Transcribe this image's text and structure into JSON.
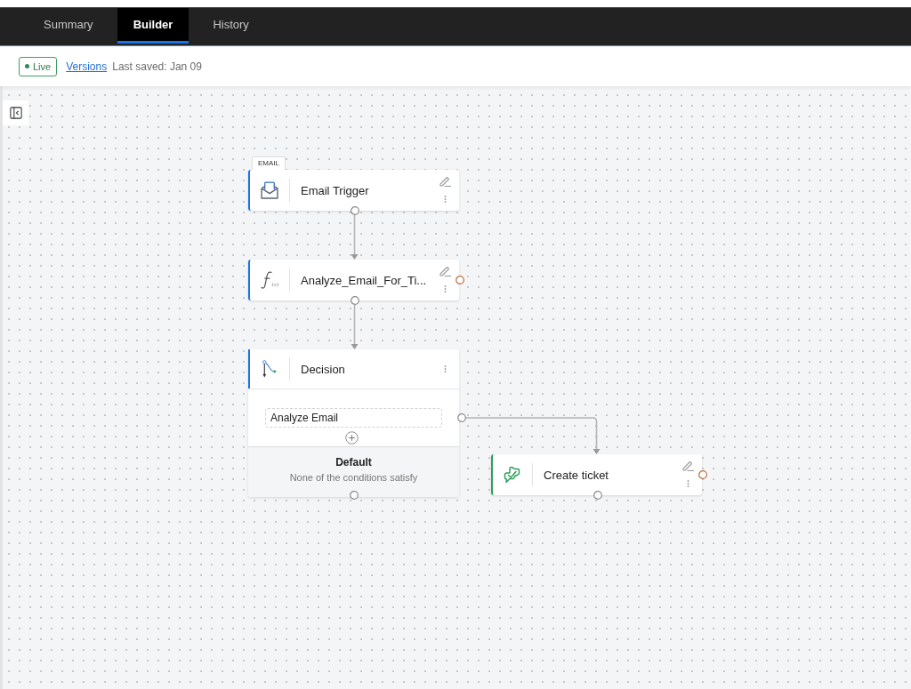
{
  "tabs": [
    {
      "label": "Summary",
      "selected": false
    },
    {
      "label": "Builder",
      "selected": true
    },
    {
      "label": "History",
      "selected": false
    }
  ],
  "toolbar": {
    "status": "Live",
    "versions_link": "Versions",
    "last_saved": "Last saved: Jan 09"
  },
  "flow": [
    {
      "kind": "trigger",
      "category": "EMAIL",
      "title": "Email Trigger",
      "color": "#1a73e8",
      "editable": true,
      "fault_port": false
    },
    {
      "kind": "function",
      "title": "Analyze_Email_For_Ti...",
      "color": "#1a73e8",
      "editable": true,
      "fault_port": true
    },
    {
      "kind": "decision",
      "title": "Decision",
      "color": "#1a73e8",
      "editable": false,
      "fault_port": false,
      "conditions": [
        {
          "label": "Analyze Email",
          "branch": {
            "kind": "ticket",
            "title": "Create ticket",
            "color": "#2e9e5b",
            "editable": true,
            "fault_port": true
          }
        }
      ],
      "default": {
        "title": "Default",
        "description": "None of the conditions satisfy"
      }
    }
  ]
}
